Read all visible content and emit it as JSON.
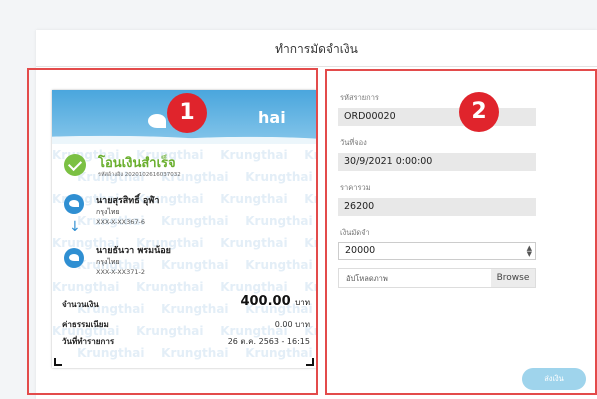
{
  "header": {
    "title": "ทำการมัดจำเงิน"
  },
  "annotations": {
    "badge1": "1",
    "badge2": "2"
  },
  "slip": {
    "bank_logo": "Krungthai",
    "logo_visible_suffix": "hai",
    "watermark_text": "Krungthai",
    "status_title": "โอนเงินสำเร็จ",
    "ref_code": "รหัสอ้างอิง 2020102616037032",
    "sender": {
      "name": "นายสุรสิทธิ์ อุฬำ",
      "bank": "กรุงไทย",
      "account": "XXX-X-XX367-6"
    },
    "receiver": {
      "name": "นายธันวา พรมน้อย",
      "bank": "กรุงไทย",
      "account": "XXX-X-XX371-2"
    },
    "amount": {
      "label": "จำนวนเงิน",
      "value": "400.00",
      "unit": "บาท"
    },
    "fee": {
      "label": "ค่าธรรมเนียม",
      "value": "0.00 บาท"
    },
    "date": {
      "label": "วันที่ทำรายการ",
      "value": "26 ต.ค. 2563 - 16:15"
    }
  },
  "form": {
    "order_id": {
      "label": "รหัสรายการ",
      "value": "ORD00020"
    },
    "booking_date": {
      "label": "วันที่จอง",
      "value": "30/9/2021 0:00:00"
    },
    "total_price": {
      "label": "ราคารวม",
      "value": "26200"
    },
    "deposit": {
      "label": "เงินมัดจำ",
      "value": "20000"
    },
    "upload": {
      "placeholder": "อัปโหลดภาพ",
      "browse_label": "Browse"
    },
    "submit_label": "ส่งเงิน"
  },
  "colors": {
    "accent": "#e0242c",
    "success": "#6aaf2e",
    "bank_blue": "#2f8fd2",
    "submit": "#9fd4ec"
  }
}
